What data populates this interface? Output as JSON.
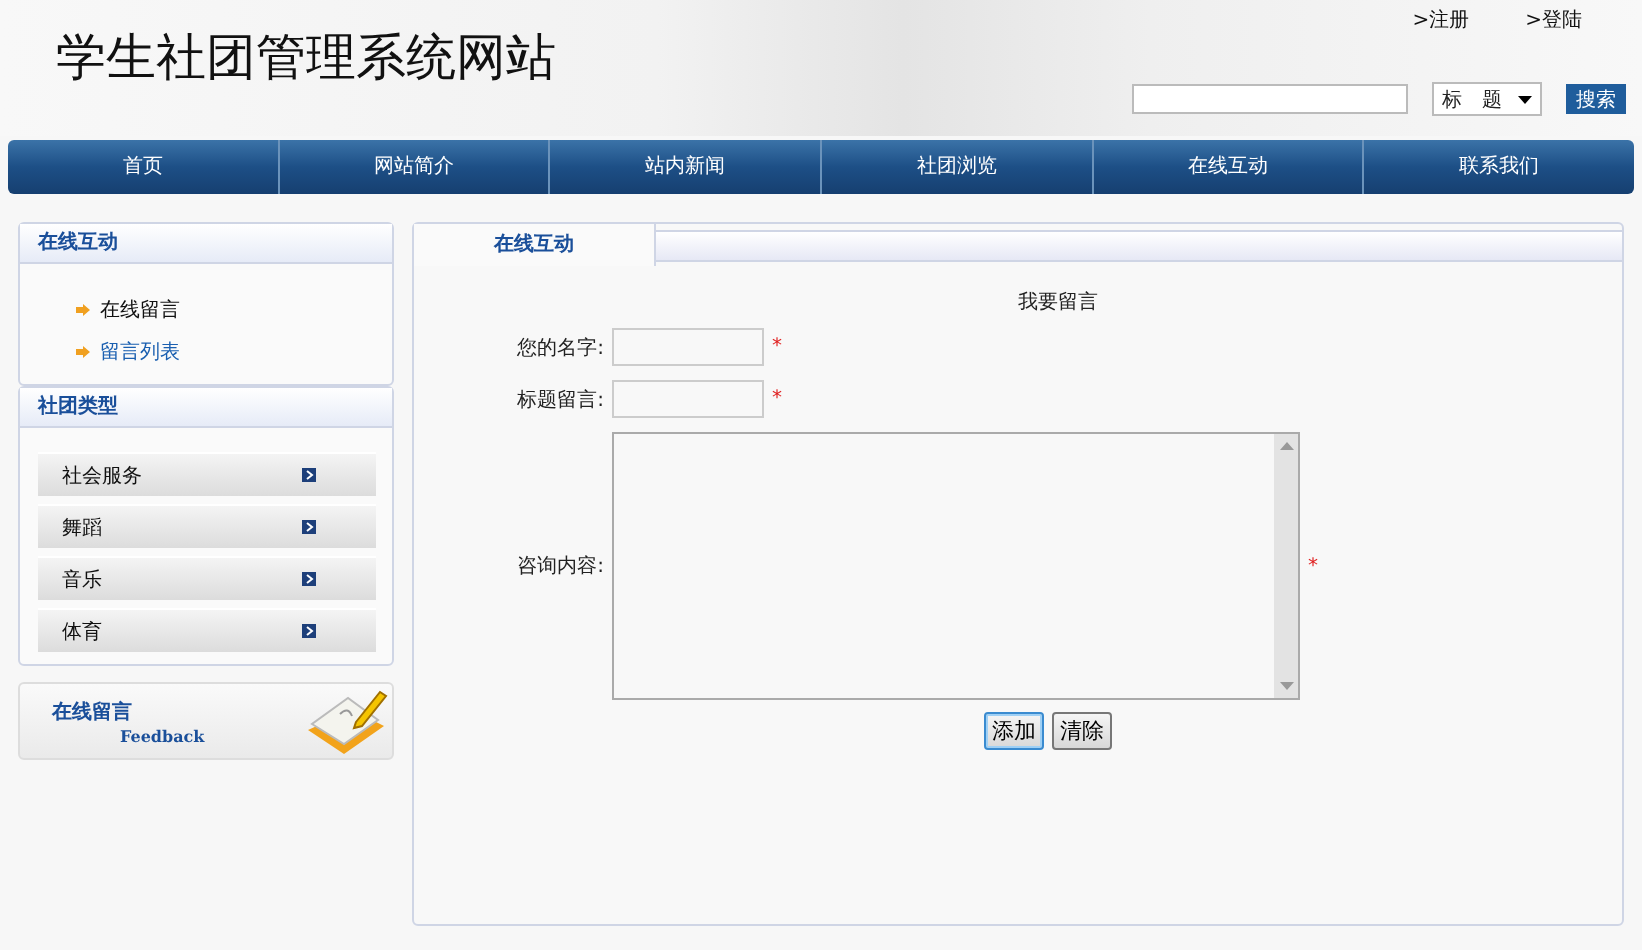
{
  "header": {
    "site_title": "学生社团管理系统网站",
    "top_links": [
      ">注册",
      ">登陆"
    ],
    "search": {
      "select": "标　题",
      "button": "搜索"
    }
  },
  "nav": [
    "首页",
    "网站简介",
    "站内新闻",
    "社团浏览",
    "在线互动",
    "联系我们"
  ],
  "sidebar": {
    "interaction": {
      "title": "在线互动",
      "links": [
        {
          "label": "在线留言",
          "selected": false
        },
        {
          "label": "留言列表",
          "selected": true
        }
      ]
    },
    "club_types": {
      "title": "社团类型",
      "items": [
        "社会服务",
        "舞蹈",
        "音乐",
        "体育"
      ]
    },
    "feedback_banner": {
      "title": "在线留言",
      "subtitle": "Feedback"
    }
  },
  "main": {
    "tab": "在线互动",
    "form_title": "我要留言",
    "fields": [
      {
        "kind": "input",
        "label": "您的名字:",
        "required_mark": "*"
      },
      {
        "kind": "input",
        "label": "标题留言:",
        "required_mark": "*"
      },
      {
        "kind": "textarea",
        "label": "咨询内容:",
        "required_mark": "*"
      }
    ],
    "buttons": [
      {
        "label": "添加",
        "focused": true
      },
      {
        "label": "清除",
        "focused": false
      }
    ]
  }
}
